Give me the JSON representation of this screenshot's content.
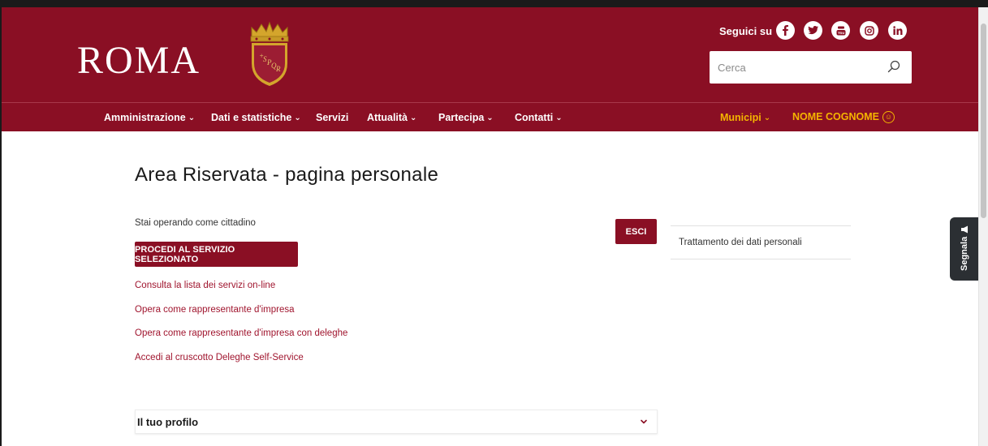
{
  "header": {
    "logo_text": "ROMA",
    "follow_label": "Seguici su",
    "social": [
      "facebook-icon",
      "twitter-icon",
      "youtube-icon",
      "instagram-icon",
      "linkedin-icon"
    ],
    "search_placeholder": "Cerca",
    "brand_color": "#8a0f24",
    "accent_color": "#f4b400"
  },
  "nav": {
    "items": [
      {
        "label": "Amministrazione",
        "dropdown": true
      },
      {
        "label": "Dati e statistiche",
        "dropdown": true
      },
      {
        "label": "Servizi",
        "dropdown": false
      },
      {
        "label": "Attualità",
        "dropdown": true
      },
      {
        "label": "Partecipa",
        "dropdown": true
      },
      {
        "label": "Contatti",
        "dropdown": true
      }
    ],
    "municipi_label": "Municipi",
    "user_label": "NOME COGNOME"
  },
  "main": {
    "title": "Area Riservata - pagina personale",
    "operating_as": "Stai operando come cittadino",
    "proceed_button": "PROCEDI AL SERVIZIO SELEZIONATO",
    "exit_button": "ESCI",
    "links": [
      "Consulta la lista dei servizi on-line",
      "Opera come rappresentante d'impresa",
      "Opera come rappresentante d'impresa con deleghe",
      "Accedi al cruscotto Deleghe Self-Service"
    ],
    "side_link": "Trattamento dei dati personali",
    "accordion_title": "Il tuo profilo"
  },
  "report_tab": {
    "label": "Segnala"
  }
}
